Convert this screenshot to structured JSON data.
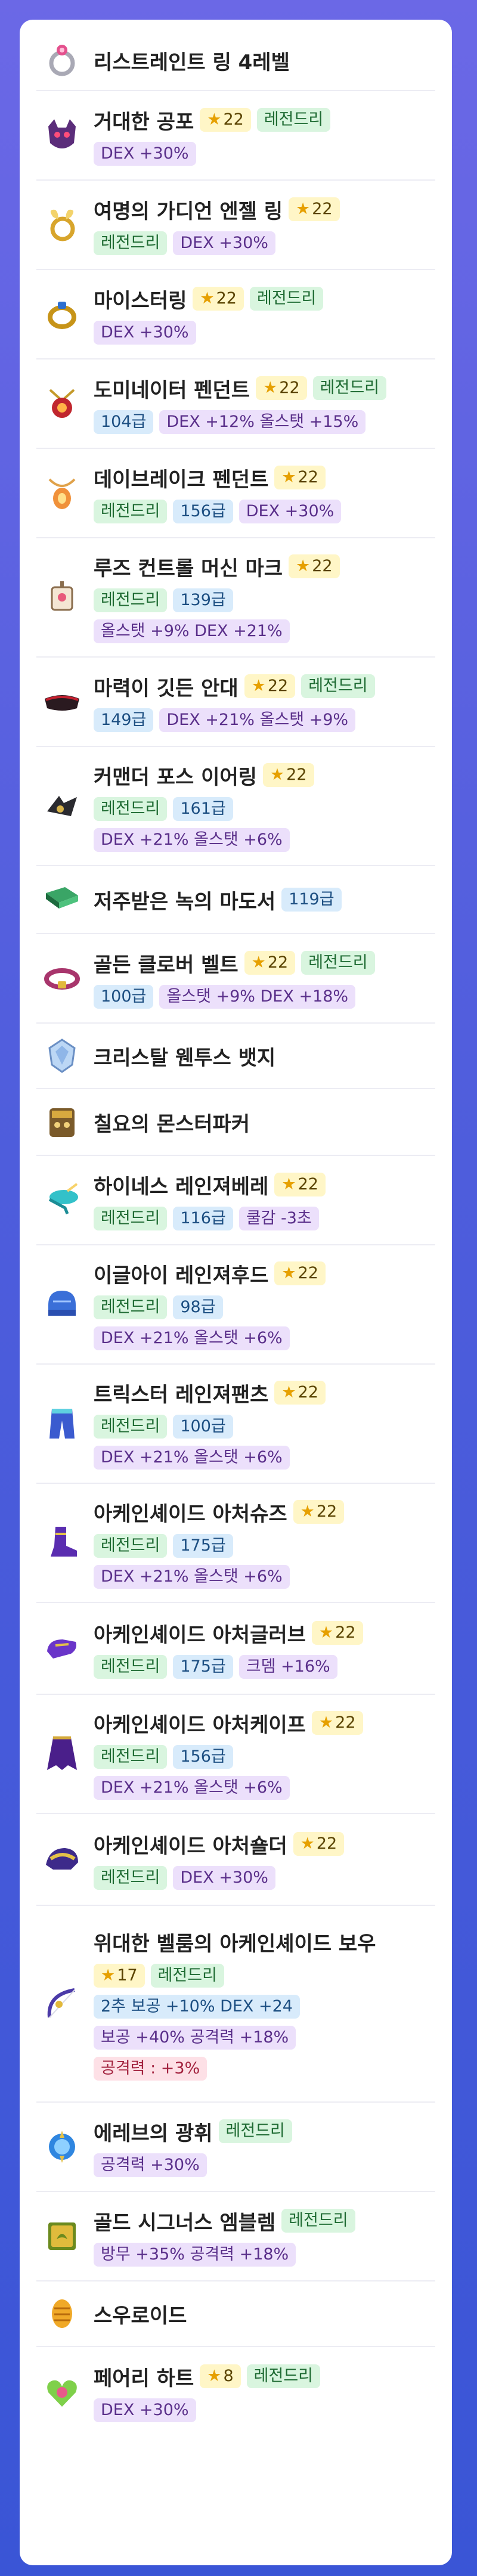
{
  "items": [
    {
      "name": "리스트레인트 링 4레벨",
      "icon": "ring-icon",
      "star": "",
      "grade": "",
      "level": "",
      "stats": []
    },
    {
      "name": "거대한 공포",
      "icon": "demon-mask-icon",
      "star": "22",
      "grade": "레전드리",
      "level": "",
      "stats": [
        "DEX +30%"
      ]
    },
    {
      "name": "여명의 가디언 엔젤 링",
      "icon": "angel-ring-icon",
      "star": "22",
      "grade": "레전드리",
      "level": "",
      "stats": [
        "DEX +30%"
      ]
    },
    {
      "name": "마이스터링",
      "icon": "meister-ring-icon",
      "star": "22",
      "grade": "레전드리",
      "level": "",
      "stats": [
        "DEX +30%"
      ]
    },
    {
      "name": "도미네이터 펜던트",
      "icon": "dominator-pendant-icon",
      "star": "22",
      "grade": "레전드리",
      "level": "104급",
      "stats": [
        "DEX +12% 올스탯 +15%"
      ]
    },
    {
      "name": "데이브레이크 펜던트",
      "icon": "daybreak-pendant-icon",
      "star": "22",
      "grade": "레전드리",
      "level": "156급",
      "stats": [
        "DEX +30%"
      ]
    },
    {
      "name": "루즈 컨트롤 머신 마크",
      "icon": "machine-mark-icon",
      "star": "22",
      "grade": "레전드리",
      "level": "139급",
      "stats": [
        "올스탯 +9% DEX +21%"
      ]
    },
    {
      "name": "마력이 깃든 안대",
      "icon": "eye-patch-icon",
      "star": "22",
      "grade": "레전드리",
      "level": "149급",
      "stats": [
        "DEX +21% 올스탯 +9%"
      ]
    },
    {
      "name": "커맨더 포스 이어링",
      "icon": "earring-icon",
      "star": "22",
      "grade": "레전드리",
      "level": "161급",
      "stats": [
        "DEX +21% 올스탯 +6%"
      ]
    },
    {
      "name": "저주받은 녹의 마도서",
      "icon": "green-book-icon",
      "star": "",
      "grade": "",
      "level": "119급",
      "stats": []
    },
    {
      "name": "골든 클로버 벨트",
      "icon": "belt-icon",
      "star": "22",
      "grade": "레전드리",
      "level": "100급",
      "stats": [
        "올스탯 +9% DEX +18%"
      ]
    },
    {
      "name": "크리스탈 웬투스 뱃지",
      "icon": "crystal-badge-icon",
      "star": "",
      "grade": "",
      "level": "",
      "stats": []
    },
    {
      "name": "칠요의 몬스터파커",
      "icon": "monster-parka-icon",
      "star": "",
      "grade": "",
      "level": "",
      "stats": []
    },
    {
      "name": "하이네스 레인져베레",
      "icon": "beret-icon",
      "star": "22",
      "grade": "레전드리",
      "level": "116급",
      "stats": [
        "쿨감 -3초"
      ]
    },
    {
      "name": "이글아이 레인져후드",
      "icon": "hood-icon",
      "star": "22",
      "grade": "레전드리",
      "level": "98급",
      "stats": [
        "DEX +21% 올스탯 +6%"
      ]
    },
    {
      "name": "트릭스터 레인져팬츠",
      "icon": "pants-icon",
      "star": "22",
      "grade": "레전드리",
      "level": "100급",
      "stats": [
        "DEX +21% 올스탯 +6%"
      ]
    },
    {
      "name": "아케인셰이드 아처슈즈",
      "icon": "shoes-icon",
      "star": "22",
      "grade": "레전드리",
      "level": "175급",
      "stats": [
        "DEX +21% 올스탯 +6%"
      ]
    },
    {
      "name": "아케인셰이드 아처글러브",
      "icon": "gloves-icon",
      "star": "22",
      "grade": "레전드리",
      "level": "175급",
      "stats": [
        "크뎀 +16%"
      ]
    },
    {
      "name": "아케인셰이드 아처케이프",
      "icon": "cape-icon",
      "star": "22",
      "grade": "레전드리",
      "level": "156급",
      "stats": [
        "DEX +21% 올스탯 +6%"
      ]
    },
    {
      "name": "아케인셰이드 아처숄더",
      "icon": "shoulder-icon",
      "star": "22",
      "grade": "레전드리",
      "level": "",
      "stats": [
        "DEX +30%"
      ]
    },
    {
      "name": "위대한 벨룸의 아케인셰이드 보우",
      "icon": "bow-icon",
      "star": "17",
      "grade": "레전드리",
      "level": "",
      "stats": [
        "2추 보공 +10% DEX +24",
        "보공 +40% 공격력 +18%"
      ],
      "extra": "공격력 : +3%"
    },
    {
      "name": "에레브의 광휘",
      "icon": "erev-emblem-icon",
      "star": "",
      "grade": "레전드리",
      "level": "",
      "stats": [
        "공격력 +30%"
      ]
    },
    {
      "name": "골드 시그너스 엠블렘",
      "icon": "cygnus-emblem-icon",
      "star": "",
      "grade": "레전드리",
      "level": "",
      "stats": [
        "방무 +35% 공격력 +18%"
      ]
    },
    {
      "name": "스우로이드",
      "icon": "android-heart-icon",
      "star": "",
      "grade": "",
      "level": "",
      "stats": []
    },
    {
      "name": "페어리 하트",
      "icon": "fairy-heart-icon",
      "star": "8",
      "grade": "레전드리",
      "level": "",
      "stats": [
        "DEX +30%"
      ]
    }
  ]
}
